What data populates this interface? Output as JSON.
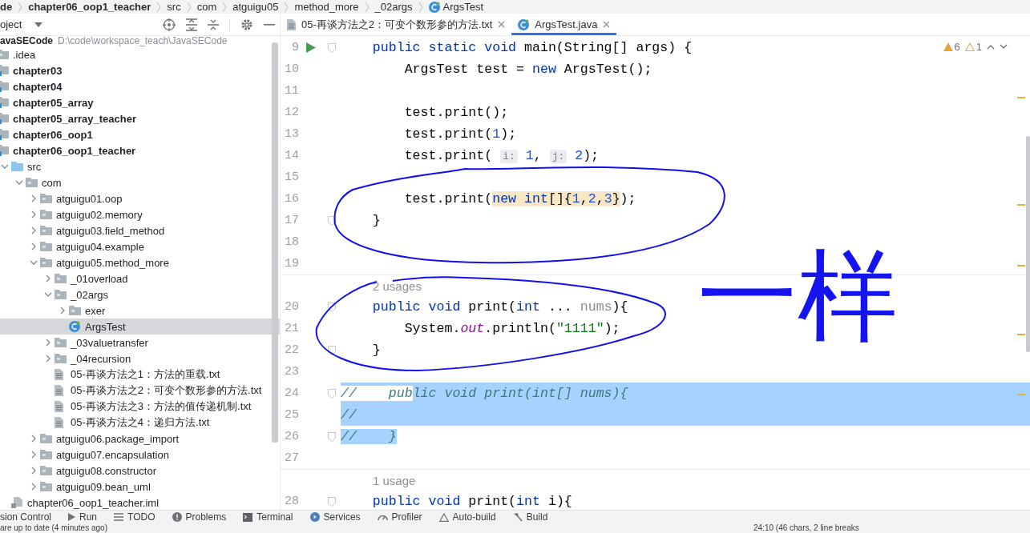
{
  "breadcrumbs": [
    {
      "label": "de",
      "kind": "project"
    },
    {
      "label": "chapter06_oop1_teacher",
      "kind": "module"
    },
    {
      "label": "src",
      "kind": "plain"
    },
    {
      "label": "com",
      "kind": "plain"
    },
    {
      "label": "atguigu05",
      "kind": "plain"
    },
    {
      "label": "method_more",
      "kind": "plain"
    },
    {
      "label": "_02args",
      "kind": "plain"
    },
    {
      "label": "ArgsTest",
      "kind": "class"
    }
  ],
  "project_panel": {
    "title": "oject"
  },
  "tabs": [
    {
      "label": "05-再谈方法之2：可变个数形参的方法.txt",
      "kind": "text",
      "selected": false
    },
    {
      "label": "ArgsTest.java",
      "kind": "class",
      "selected": true
    }
  ],
  "tree": {
    "root": {
      "label": "avaSECode",
      "path": "D:\\code\\workspace_teach\\JavaSECode"
    },
    "children": [
      {
        "label": ".idea",
        "kind": "folder",
        "selected": false
      },
      {
        "label": "chapter03",
        "kind": "module",
        "selected": false
      },
      {
        "label": "chapter04",
        "kind": "module",
        "selected": false
      },
      {
        "label": "chapter05_array",
        "kind": "module",
        "selected": false
      },
      {
        "label": "chapter05_array_teacher",
        "kind": "module",
        "selected": false
      },
      {
        "label": "chapter06_oop1",
        "kind": "module",
        "selected": false
      },
      {
        "label": "chapter06_oop1_teacher",
        "kind": "module",
        "selected": false,
        "children": [
          {
            "label": "src",
            "kind": "source",
            "expanded": true,
            "selected": false,
            "children": [
              {
                "label": "com",
                "kind": "package",
                "expanded": true,
                "selected": false,
                "children": [
                  {
                    "label": "atguigu01.oop",
                    "kind": "package",
                    "expanded": false,
                    "selected": false
                  },
                  {
                    "label": "atguigu02.memory",
                    "kind": "package",
                    "expanded": false,
                    "selected": false
                  },
                  {
                    "label": "atguigu03.field_method",
                    "kind": "package",
                    "expanded": false,
                    "selected": false
                  },
                  {
                    "label": "atguigu04.example",
                    "kind": "package",
                    "expanded": false,
                    "selected": false
                  },
                  {
                    "label": "atguigu05.method_more",
                    "kind": "package",
                    "expanded": true,
                    "selected": false,
                    "children": [
                      {
                        "label": "_01overload",
                        "kind": "package",
                        "expanded": false,
                        "selected": false
                      },
                      {
                        "label": "_02args",
                        "kind": "package",
                        "expanded": true,
                        "selected": false,
                        "children": [
                          {
                            "label": "exer",
                            "kind": "package",
                            "expanded": false,
                            "selected": false
                          },
                          {
                            "label": "ArgsTest",
                            "kind": "class",
                            "selected": true
                          }
                        ]
                      },
                      {
                        "label": "_03valuetransfer",
                        "kind": "package",
                        "expanded": false,
                        "selected": false
                      },
                      {
                        "label": "_04recursion",
                        "kind": "package",
                        "expanded": false,
                        "selected": false
                      },
                      {
                        "label": "05-再谈方法之1：方法的重载.txt",
                        "kind": "text",
                        "selected": false
                      },
                      {
                        "label": "05-再谈方法之2：可变个数形参的方法.txt",
                        "kind": "text",
                        "selected": false
                      },
                      {
                        "label": "05-再谈方法之3：方法的值传递机制.txt",
                        "kind": "text",
                        "selected": false
                      },
                      {
                        "label": "05-再谈方法之4：递归方法.txt",
                        "kind": "text",
                        "selected": false
                      }
                    ]
                  },
                  {
                    "label": "atguigu06.package_import",
                    "kind": "package",
                    "expanded": false,
                    "selected": false
                  },
                  {
                    "label": "atguigu07.encapsulation",
                    "kind": "package",
                    "expanded": false,
                    "selected": false
                  },
                  {
                    "label": "atguigu08.constructor",
                    "kind": "package",
                    "expanded": false,
                    "selected": false
                  },
                  {
                    "label": "atguigu09.bean_uml",
                    "kind": "package",
                    "expanded": false,
                    "selected": false
                  }
                ]
              }
            ]
          },
          {
            "label": "chapter06_oop1_teacher.iml",
            "kind": "iml",
            "selected": false
          }
        ]
      }
    ]
  },
  "editor": {
    "inspections": {
      "warnings": "6",
      "weak_warnings": "1"
    },
    "lines": [
      {
        "kind": "code",
        "number": "9",
        "run": true,
        "fold": true,
        "tokens": [
          {
            "t": "    public static void",
            "kind": "keyword"
          },
          {
            "t": " main(String[] args) {"
          }
        ]
      },
      {
        "kind": "code",
        "number": "10",
        "tokens": [
          {
            "t": "        ArgsTest test = "
          },
          {
            "t": "new",
            "kind": "keyword"
          },
          {
            "t": " ArgsTest();"
          }
        ]
      },
      {
        "kind": "code",
        "number": "11"
      },
      {
        "kind": "code",
        "number": "12",
        "tokens": [
          {
            "t": "        test.print();"
          }
        ]
      },
      {
        "kind": "code",
        "number": "13",
        "tokens": [
          {
            "t": "        test.print("
          },
          {
            "t": "1",
            "kind": "number"
          },
          {
            "t": ");"
          }
        ]
      },
      {
        "kind": "code",
        "number": "14",
        "tokens": [
          {
            "t": "        test.print( "
          },
          {
            "t": "i:",
            "kind": "hint"
          },
          {
            "t": " 1",
            "kind": "number"
          },
          {
            "t": ", "
          },
          {
            "t": "j:",
            "kind": "hint"
          },
          {
            "t": " 2",
            "kind": "number"
          },
          {
            "t": ");"
          }
        ]
      },
      {
        "kind": "code",
        "number": "15"
      },
      {
        "kind": "code",
        "number": "16",
        "tokens": [
          {
            "t": "        test.print("
          },
          {
            "t": "new int",
            "kind": "keyword",
            "highlighted": true
          },
          {
            "t": "[]{",
            "highlighted": true
          },
          {
            "t": "1",
            "kind": "number",
            "highlighted": true
          },
          {
            "t": ",",
            "highlighted": true
          },
          {
            "t": "2",
            "kind": "number",
            "highlighted": true
          },
          {
            "t": ",",
            "highlighted": true
          },
          {
            "t": "3",
            "kind": "number",
            "highlighted": true
          },
          {
            "t": "}",
            "highlighted": true
          },
          {
            "t": ");"
          }
        ]
      },
      {
        "kind": "code",
        "number": "17",
        "fold": true,
        "tokens": [
          {
            "t": "    }"
          }
        ]
      },
      {
        "kind": "code",
        "number": "18"
      },
      {
        "kind": "code",
        "number": "19"
      },
      {
        "kind": "usages",
        "text": "2 usages"
      },
      {
        "kind": "code",
        "number": "20",
        "fold": true,
        "tokens": [
          {
            "t": "    public void",
            "kind": "keyword"
          },
          {
            "t": " print("
          },
          {
            "t": "int",
            "kind": "keyword"
          },
          {
            "t": " ... "
          },
          {
            "t": "nums",
            "kind": "param"
          },
          {
            "t": "){"
          }
        ]
      },
      {
        "kind": "code",
        "number": "21",
        "tokens": [
          {
            "t": "        System."
          },
          {
            "t": "out",
            "kind": "field"
          },
          {
            "t": ".println("
          },
          {
            "t": "\"1111\"",
            "kind": "string"
          },
          {
            "t": ");"
          }
        ]
      },
      {
        "kind": "code",
        "number": "22",
        "fold": true,
        "tokens": [
          {
            "t": "    }"
          }
        ]
      },
      {
        "kind": "code",
        "number": "23"
      },
      {
        "kind": "code",
        "number": "24",
        "fold": true,
        "selected_to_end": true,
        "tokens": [
          {
            "t": "//    pub",
            "kind": "comment",
            "selected": false
          },
          {
            "t": "lic void print(int[] nums){",
            "kind": "comment",
            "selected": true
          }
        ]
      },
      {
        "kind": "code",
        "number": "25",
        "selected_to_end": true,
        "tokens": [
          {
            "t": "//",
            "kind": "comment",
            "selected": true
          }
        ]
      },
      {
        "kind": "code",
        "number": "26",
        "fold": true,
        "tokens": [
          {
            "t": "//    }",
            "kind": "comment",
            "selected": true
          }
        ]
      },
      {
        "kind": "code",
        "number": "27"
      },
      {
        "kind": "usages",
        "text": "1 usage"
      },
      {
        "kind": "code",
        "number": "28",
        "fold": true,
        "tokens": [
          {
            "t": "    public void",
            "kind": "keyword"
          },
          {
            "t": " print("
          },
          {
            "t": "int",
            "kind": "keyword"
          },
          {
            "t": " i){"
          }
        ]
      }
    ]
  },
  "annotation": {
    "handwriting": "一样"
  },
  "tool_windows": [
    {
      "label": "sion Control",
      "kind": "vcs"
    },
    {
      "label": "Run",
      "kind": "run"
    },
    {
      "label": "TODO",
      "kind": "todo"
    },
    {
      "label": "Problems",
      "kind": "problems"
    },
    {
      "label": "Terminal",
      "kind": "terminal"
    },
    {
      "label": "Services",
      "kind": "services"
    },
    {
      "label": "Profiler",
      "kind": "profiler"
    },
    {
      "label": "Auto-build",
      "kind": "autobuild"
    },
    {
      "label": "Build",
      "kind": "build"
    }
  ],
  "status_bar": {
    "message": "are up to date (4 minutes ago)",
    "position": "24:10 (46 chars, 2 line breaks"
  }
}
